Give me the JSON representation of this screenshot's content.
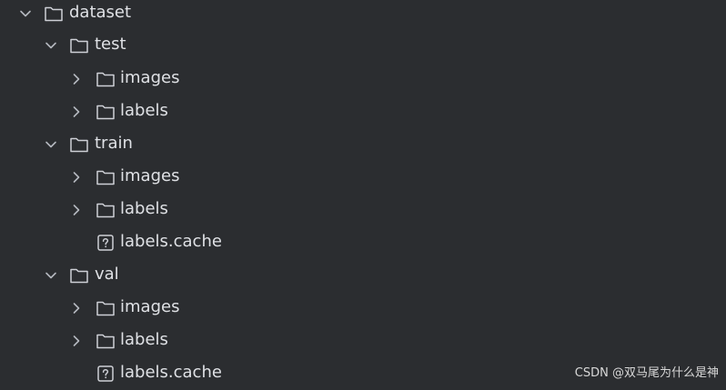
{
  "tree": {
    "root": {
      "label": "dataset",
      "icon": "folder-icon",
      "expanded": true
    },
    "test": {
      "label": "test",
      "icon": "folder-icon",
      "expanded": true,
      "images": {
        "label": "images",
        "icon": "folder-icon",
        "expanded": false
      },
      "labels": {
        "label": "labels",
        "icon": "folder-icon",
        "expanded": false
      }
    },
    "train": {
      "label": "train",
      "icon": "folder-icon",
      "expanded": true,
      "images": {
        "label": "images",
        "icon": "folder-icon",
        "expanded": false
      },
      "labels": {
        "label": "labels",
        "icon": "folder-icon",
        "expanded": false
      },
      "cache": {
        "label": "labels.cache",
        "icon": "unknown-file-icon"
      }
    },
    "val": {
      "label": "val",
      "icon": "folder-icon",
      "expanded": true,
      "images": {
        "label": "images",
        "icon": "folder-icon",
        "expanded": false
      },
      "labels": {
        "label": "labels",
        "icon": "folder-icon",
        "expanded": false
      },
      "cache": {
        "label": "labels.cache",
        "icon": "unknown-file-icon"
      }
    }
  },
  "watermark": "CSDN @双马尾为什么是神",
  "colors": {
    "background": "#2b2d30",
    "text": "#dfe1e5",
    "icon": "#ced0d6",
    "chevron": "#b4b8bf"
  }
}
